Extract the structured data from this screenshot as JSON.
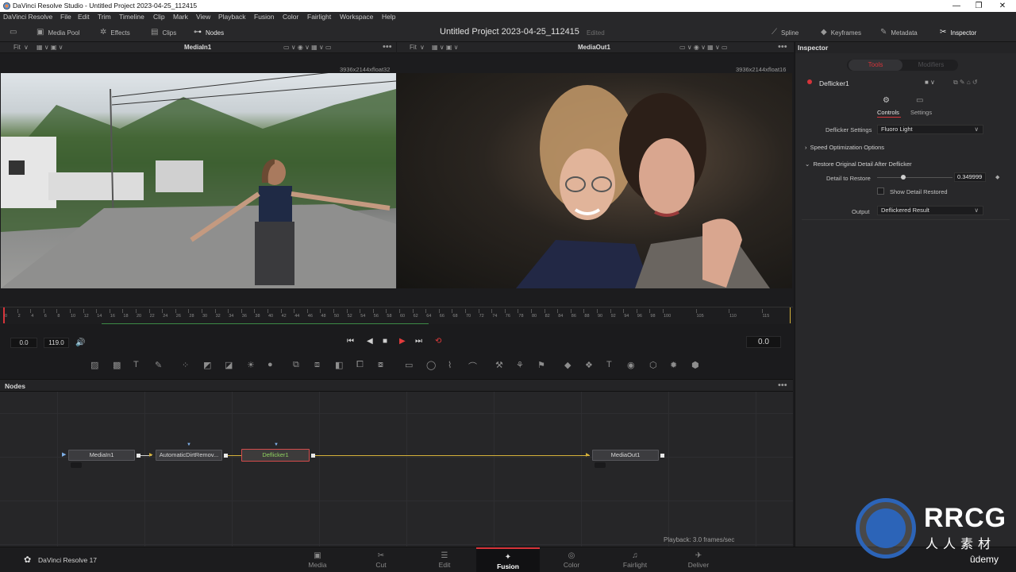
{
  "window": {
    "title": "DaVinci Resolve Studio - Untitled Project 2023-04-25_112415",
    "controls": [
      "—",
      "❐",
      "✕"
    ]
  },
  "menu": [
    "DaVinci Resolve",
    "File",
    "Edit",
    "Trim",
    "Timeline",
    "Clip",
    "Mark",
    "View",
    "Playback",
    "Fusion",
    "Color",
    "Fairlight",
    "Workspace",
    "Help"
  ],
  "toolbar": {
    "media_pool": "Media Pool",
    "effects": "Effects",
    "clips": "Clips",
    "nodes": "Nodes",
    "project_title": "Untitled Project 2023-04-25_112415",
    "edited": "Edited",
    "spline": "Spline",
    "keyframes": "Keyframes",
    "metadata": "Metadata",
    "inspector": "Inspector"
  },
  "viewers": {
    "left": {
      "zoom": "Fit",
      "name": "MediaIn1",
      "resolution": "3936x2144xfloat32"
    },
    "right": {
      "zoom": "Fit",
      "name": "MediaOut1",
      "resolution": "3936x2144xfloat16"
    }
  },
  "ruler": {
    "labels": [
      "0",
      "2",
      "4",
      "6",
      "8",
      "10",
      "12",
      "14",
      "16",
      "18",
      "20",
      "22",
      "24",
      "26",
      "28",
      "30",
      "32",
      "34",
      "36",
      "38",
      "40",
      "42",
      "44",
      "46",
      "48",
      "50",
      "52",
      "54",
      "56",
      "58",
      "60",
      "62",
      "64",
      "66",
      "68",
      "70",
      "72",
      "74",
      "76",
      "78",
      "80",
      "82",
      "84",
      "86",
      "88",
      "90",
      "92",
      "94",
      "96",
      "98",
      "100",
      "105",
      "110",
      "115"
    ]
  },
  "transport": {
    "start": "0.0",
    "end": "119.0",
    "current": "0.0"
  },
  "nodes_panel": {
    "title": "Nodes",
    "nodes": [
      "MediaIn1",
      "AutomaticDirtRemov...",
      "Deflicker1",
      "MediaOut1"
    ],
    "playback": "Playback: 3.0 frames/sec"
  },
  "inspector": {
    "title": "Inspector",
    "tabs": [
      "Tools",
      "Modifiers"
    ],
    "tool_name": "Deflicker1",
    "subtabs": [
      "Controls",
      "Settings"
    ],
    "deflicker_settings_label": "Deflicker Settings",
    "deflicker_settings_value": "Fluoro Light",
    "speed_section": "Speed Optimization Options",
    "restore_section": "Restore Original Detail After Deflicker",
    "detail_label": "Detail to Restore",
    "detail_value": "0.349999",
    "show_detail_label": "Show Detail Restored",
    "output_label": "Output",
    "output_value": "Deflickered Result"
  },
  "pages": [
    "Media",
    "Cut",
    "Edit",
    "Fusion",
    "Color",
    "Fairlight",
    "Deliver"
  ],
  "active_page": "Fusion",
  "brand": "DaVinci Resolve 17",
  "watermark": {
    "logo_text": "RRCG",
    "cn_text": "人人素材",
    "udemy": "ûdemy"
  },
  "colors": {
    "accent_red": "#d6343a",
    "link_yellow": "#d6b23a",
    "node_selected_text": "#8ed160"
  }
}
